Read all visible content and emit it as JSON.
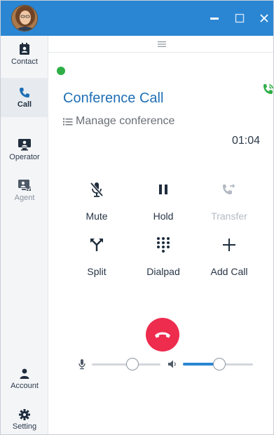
{
  "sidebar": {
    "items": [
      {
        "label": "Contact",
        "icon": "contact-card-icon"
      },
      {
        "label": "Call",
        "icon": "phone-icon"
      },
      {
        "label": "Operator",
        "icon": "operator-monitor-icon"
      },
      {
        "label": "Agent",
        "icon": "agent-icon"
      },
      {
        "label": "Account",
        "icon": "person-icon"
      },
      {
        "label": "Setting",
        "icon": "gear-icon"
      }
    ]
  },
  "call": {
    "title": "Conference Call",
    "manage_label": "Manage conference",
    "timer": "01:04",
    "status": "active"
  },
  "controls": {
    "mute": "Mute",
    "hold": "Hold",
    "transfer": "Transfer",
    "split": "Split",
    "dialpad": "Dialpad",
    "add_call": "Add Call"
  },
  "audio": {
    "mic_level": 0.59,
    "speaker_level": 0.52
  },
  "colors": {
    "titlebar": "#2a86d3",
    "accent": "#1f6fb5",
    "hangup": "#ee2c4e",
    "status_green": "#2fae46",
    "disabled": "#b3bac3"
  }
}
